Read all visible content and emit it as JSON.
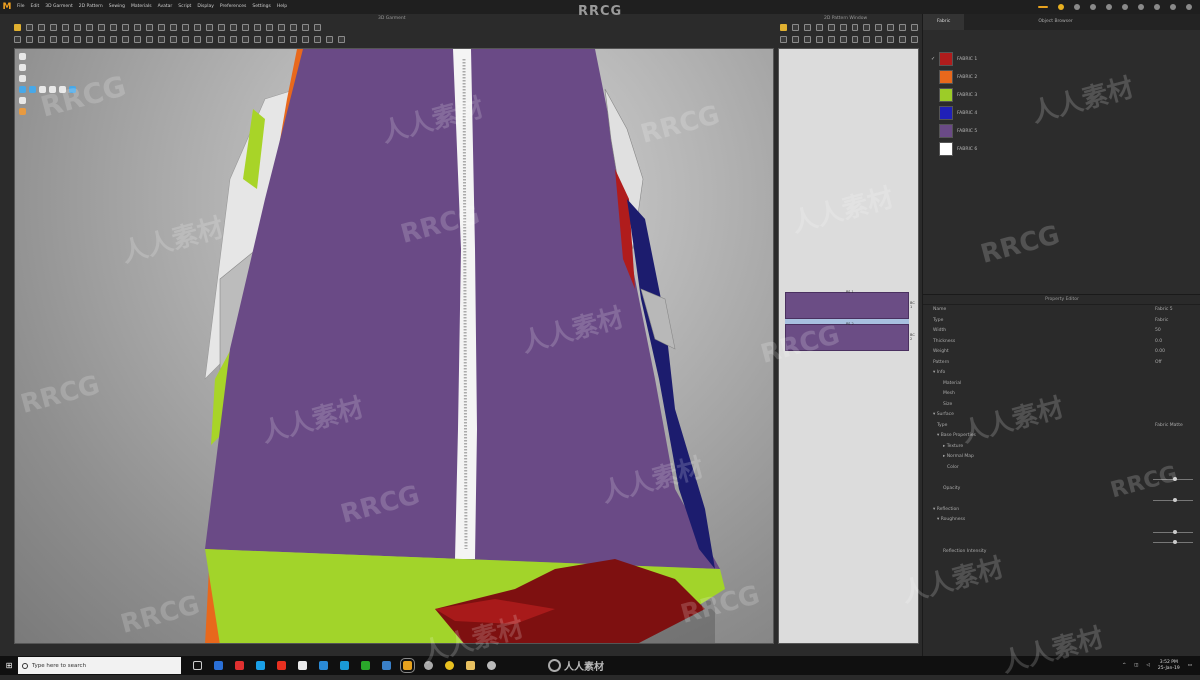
{
  "menubar": {
    "logo": "M",
    "items": [
      "File",
      "Edit",
      "3D Garment",
      "2D Pattern",
      "Sewing",
      "Materials",
      "Avatar",
      "Script",
      "Display",
      "Preferences",
      "Settings",
      "Help"
    ],
    "watermark": "RRCG"
  },
  "windows": {
    "viewport_title": "3D Garment",
    "pattern_title": "2D Pattern Window"
  },
  "right_panel": {
    "tabs": [
      "Fabric",
      "Object Browser"
    ],
    "fabrics": [
      {
        "label": "FABRIC 1",
        "color": "#b01c1c"
      },
      {
        "label": "FABRIC 2",
        "color": "#e8681c"
      },
      {
        "label": "FABRIC 3",
        "color": "#9ccc28"
      },
      {
        "label": "FABRIC 4",
        "color": "#2020b8"
      },
      {
        "label": "FABRIC 5",
        "color": "#6a4a86"
      },
      {
        "label": "FABRIC 6",
        "color": "#ffffff"
      }
    ],
    "property_editor": {
      "title": "Property Editor",
      "rows": [
        {
          "label": "Name",
          "value": "Fabric 5",
          "indent": 0
        },
        {
          "label": "Type",
          "value": "Fabric",
          "indent": 0
        },
        {
          "label": "Width",
          "value": "50",
          "indent": 0
        },
        {
          "label": "Thickness",
          "value": "0.0",
          "indent": 0
        },
        {
          "label": "Weight",
          "value": "0.00",
          "indent": 0
        },
        {
          "label": "Pattern",
          "value": "Off",
          "indent": 0
        },
        {
          "label": "▾ Info",
          "value": "",
          "indent": 0
        },
        {
          "label": "Material",
          "value": "",
          "indent": 2
        },
        {
          "label": "Mesh",
          "value": "",
          "indent": 2
        },
        {
          "label": "Size",
          "value": "",
          "indent": 2
        },
        {
          "label": "▾ Surface",
          "value": "",
          "indent": 0
        },
        {
          "label": "Type",
          "value": "Fabric Matte",
          "indent": 1
        },
        {
          "label": "▾ Base Properties",
          "value": "",
          "indent": 1
        },
        {
          "label": "▸ Texture",
          "value": "",
          "indent": 2
        },
        {
          "label": "▸ Normal Map",
          "value": "",
          "indent": 2
        },
        {
          "label": "Color",
          "value": "",
          "indent": 3
        },
        {
          "label": "",
          "value": "",
          "indent": 0
        },
        {
          "label": "Opacity",
          "value": "",
          "indent": 2
        },
        {
          "label": "",
          "value": "",
          "indent": 0
        },
        {
          "label": "▾ Reflection",
          "value": "",
          "indent": 0
        },
        {
          "label": "▾ Roughness",
          "value": "",
          "indent": 1
        },
        {
          "label": "",
          "value": "",
          "indent": 0
        },
        {
          "label": "",
          "value": "",
          "indent": 0
        },
        {
          "label": "Reflection Intensity",
          "value": "",
          "indent": 2
        }
      ]
    }
  },
  "pattern_pieces": [
    {
      "top_tag": "PS 1",
      "right_tag": "BC 1"
    },
    {
      "top_tag": "PS 2",
      "right_tag": "BC 2"
    }
  ],
  "taskbar": {
    "search_placeholder": "Type here to search",
    "time": "3:52 PM",
    "date": "25-Jan-19",
    "center_watermark": "人人素材"
  },
  "watermarks": [
    "RRCG",
    "人人素材"
  ],
  "colors": {
    "purple": "#6a4a86",
    "orange": "#e8681c",
    "lime": "#9ccc28",
    "red": "#9a1818",
    "navy": "#1c1c6e",
    "accent": "#e8a21e"
  }
}
